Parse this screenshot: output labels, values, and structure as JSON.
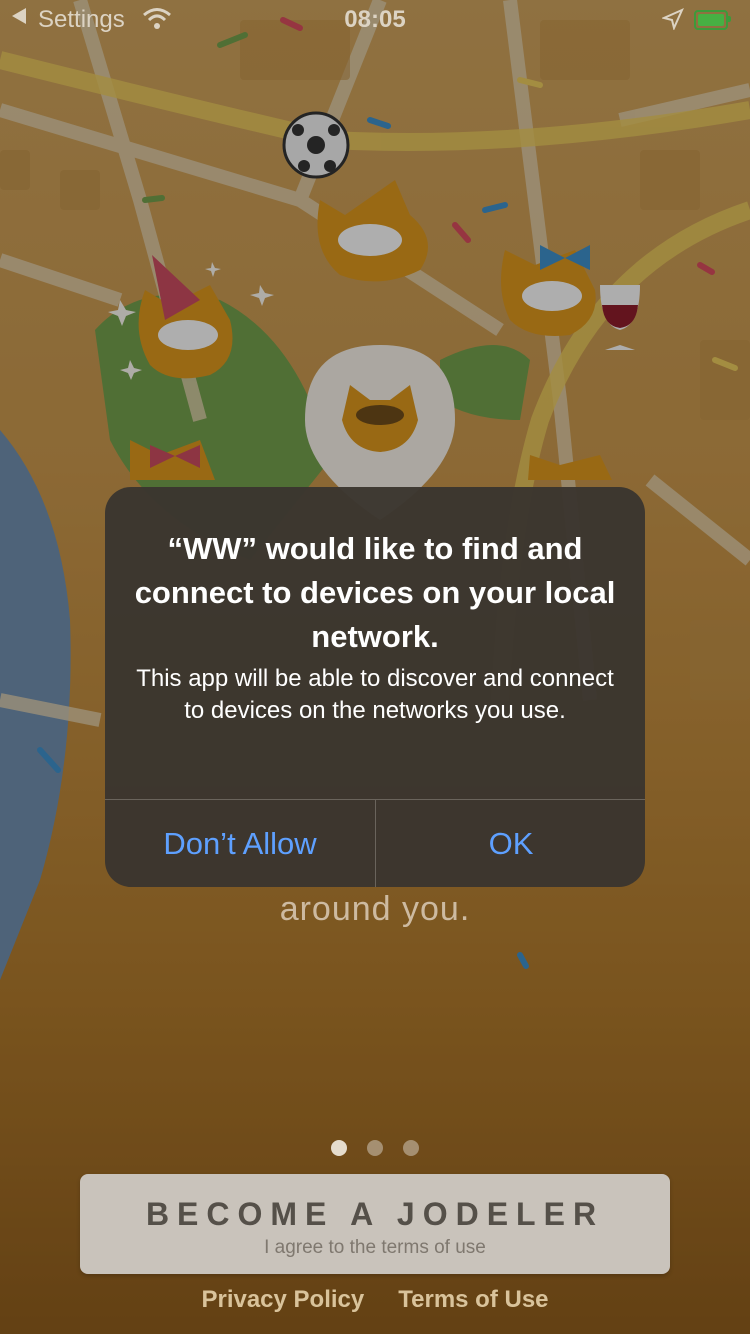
{
  "status_bar": {
    "back_label": "Settings",
    "time": "08:05"
  },
  "onboarding": {
    "tagline_fragment": "around you.",
    "page_indicator": {
      "total": 3,
      "active": 1
    },
    "cta": {
      "title": "BECOME A JODELER",
      "subtitle": "I agree to the terms of use"
    },
    "links": {
      "privacy": "Privacy Policy",
      "terms": "Terms of Use"
    }
  },
  "alert": {
    "title": "“WW” would like to find and connect to devices on your local network.",
    "message": "This app will be able to discover and connect to devices on the networks you use.",
    "buttons": {
      "deny": "Don’t Allow",
      "allow": "OK"
    }
  },
  "colors": {
    "alert_button": "#5ea0ff",
    "battery": "#46b043"
  }
}
